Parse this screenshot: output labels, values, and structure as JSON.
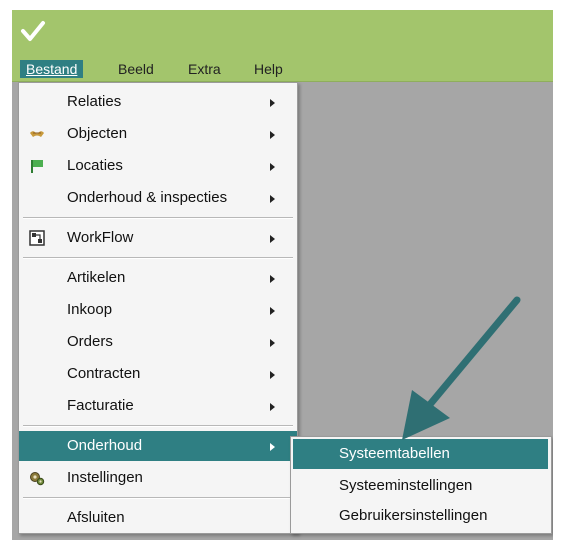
{
  "menubar": {
    "items": [
      {
        "label": "Bestand",
        "active": true
      },
      {
        "label": "Beeld"
      },
      {
        "label": "Extra"
      },
      {
        "label": "Help"
      }
    ]
  },
  "main_menu": {
    "items": [
      {
        "label": "Relaties",
        "has_submenu": true
      },
      {
        "label": "Objecten",
        "has_submenu": true,
        "icon": "objects-icon"
      },
      {
        "label": "Locaties",
        "has_submenu": true,
        "icon": "location-flag-icon"
      },
      {
        "label": "Onderhoud & inspecties",
        "has_submenu": true
      },
      {
        "label": "WorkFlow",
        "has_submenu": true,
        "icon": "workflow-icon"
      },
      {
        "label": "Artikelen",
        "has_submenu": true
      },
      {
        "label": "Inkoop",
        "has_submenu": true
      },
      {
        "label": "Orders",
        "has_submenu": true
      },
      {
        "label": "Contracten",
        "has_submenu": true
      },
      {
        "label": "Facturatie",
        "has_submenu": true
      },
      {
        "label": "Onderhoud",
        "has_submenu": true,
        "active": true
      },
      {
        "label": "Instellingen",
        "icon": "settings-icon"
      },
      {
        "label": "Afsluiten"
      }
    ]
  },
  "sub_menu": {
    "items": [
      {
        "label": "Systeemtabellen",
        "active": true
      },
      {
        "label": "Systeeminstellingen"
      },
      {
        "label": "Gebruikersinstellingen"
      }
    ]
  },
  "colors": {
    "titlebar": "#a3c56c",
    "highlight": "#2f7f83",
    "workspace": "#a6a6a6",
    "pointer_arrow": "#2f6f73"
  }
}
